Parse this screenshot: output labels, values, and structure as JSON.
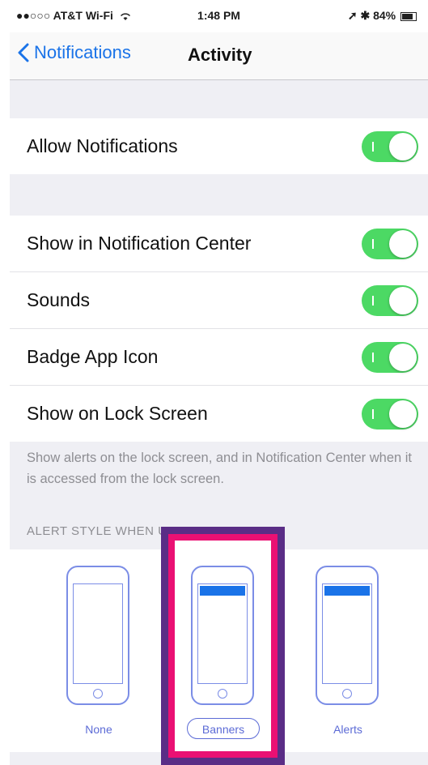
{
  "status_bar": {
    "carrier": "●●○○○ AT&T Wi-Fi",
    "wifi_icon": "wifi-icon",
    "time": "1:48 PM",
    "location_icon": "location-arrow-icon",
    "bluetooth_icon": "bluetooth-icon",
    "battery_percent": "84%",
    "battery_level": 0.84
  },
  "nav": {
    "back_label": "Notifications",
    "title": "Activity"
  },
  "allow_group": {
    "allow_notifications": {
      "label": "Allow Notifications",
      "on": true
    }
  },
  "settings": [
    {
      "label": "Show in Notification Center",
      "on": true
    },
    {
      "label": "Sounds",
      "on": true
    },
    {
      "label": "Badge App Icon",
      "on": true
    },
    {
      "label": "Show on Lock Screen",
      "on": true
    }
  ],
  "lock_screen_footnote": "Show alerts on the lock screen, and in Notification Center when it is accessed from the lock screen.",
  "alert_style": {
    "header": "ALERT STYLE WHEN UNLOCKED",
    "options": [
      {
        "label": "None",
        "selected": false
      },
      {
        "label": "Banners",
        "selected": true
      },
      {
        "label": "Alerts",
        "selected": false
      }
    ]
  },
  "colors": {
    "toggle_on": "#4cd964",
    "ios_blue": "#1a73e8",
    "highlight_outer": "#5a2d86",
    "highlight_inner": "#ea1073"
  }
}
